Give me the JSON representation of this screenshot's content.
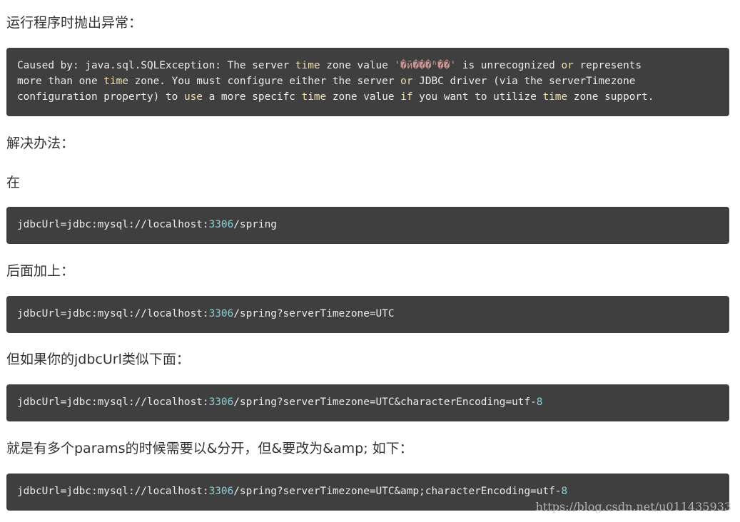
{
  "paragraphs": {
    "p1": "运行程序时抛出异常：",
    "p2": "解决办法：",
    "p3": "在",
    "p4": "后面加上：",
    "p5": "但如果你的jdbcUrl类似下面：",
    "p6": "就是有多个params的时候需要以&分开，但&要改为&amp; 如下："
  },
  "code1": {
    "l1a": "Caused by: java.sql.SQLException: The server ",
    "l1b": "time",
    "l1c": " zone value ",
    "l1d": "'�й���ʱ��'",
    "l1e": " is unrecognized ",
    "l1f": "or",
    "l1g": " represents",
    "l2a": "more than one ",
    "l2b": "time",
    "l2c": " zone. You must configure either the server ",
    "l2d": "or",
    "l2e": " JDBC driver (via the serverTimezone",
    "l3a": "configuration property) to ",
    "l3b": "use",
    "l3c": " a more specifc ",
    "l3d": "time",
    "l3e": " zone value ",
    "l3f": "if",
    "l3g": " you want to utilize ",
    "l3h": "time",
    "l3i": " zone support."
  },
  "code2": {
    "a": "jdbcUrl=jdbc:mysql://localhost:",
    "port": "3306",
    "b": "/spring"
  },
  "code3": {
    "a": "jdbcUrl=jdbc:mysql://localhost:",
    "port": "3306",
    "b": "/spring?serverTimezone=UTC"
  },
  "code4": {
    "a": "jdbcUrl=jdbc:mysql://localhost:",
    "port": "3306",
    "b": "/spring?serverTimezone=UTC&characterEncoding=utf-",
    "n": "8"
  },
  "code5": {
    "a": "jdbcUrl=jdbc:mysql://localhost:",
    "port": "3306",
    "b": "/spring?serverTimezone=UTC&amp;characterEncoding=utf-",
    "n": "8"
  },
  "watermark": "https://blog.csdn.net/u011435933",
  "colors": {
    "code_bg": "#3f3f3f",
    "code_text": "#ececec",
    "keyword": "#f0dfaf",
    "string": "#cc9393",
    "number": "#8cd0d3"
  }
}
